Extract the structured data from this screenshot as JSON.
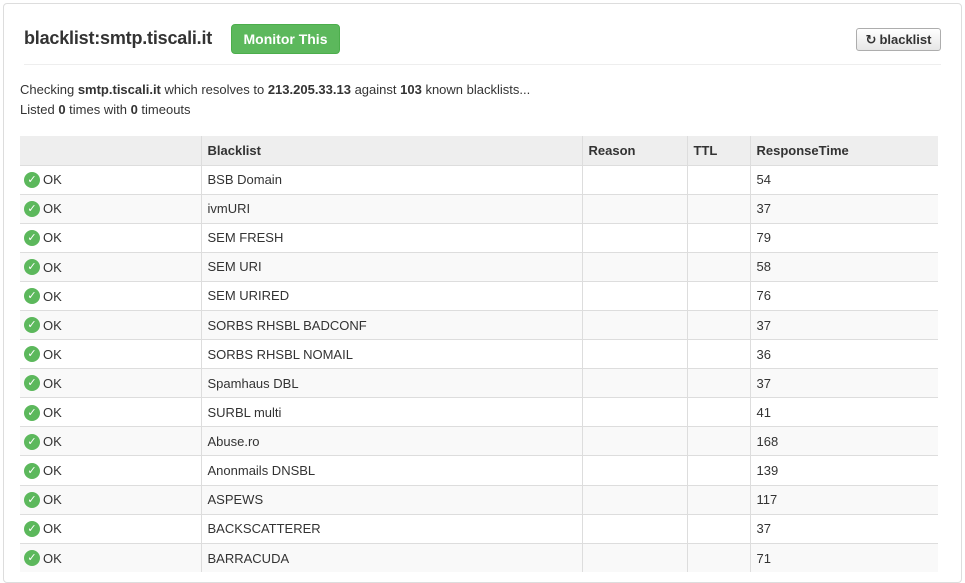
{
  "header": {
    "title": "blacklist:smtp.tiscali.it",
    "monitor_label": "Monitor This",
    "refresh_label": "blacklist",
    "refresh_icon": "refresh-icon"
  },
  "info": {
    "checking_prefix": "Checking ",
    "host": "smtp.tiscali.it",
    "resolves_text": " which resolves to ",
    "ip": "213.205.33.13",
    "against_text": " against ",
    "count": "103",
    "known_text": " known blacklists...",
    "listed_prefix": "Listed ",
    "listed_count": "0",
    "times_with": " times with ",
    "timeout_count": "0",
    "timeouts_text": " timeouts"
  },
  "table": {
    "columns": [
      "",
      "Blacklist",
      "Reason",
      "TTL",
      "ResponseTime"
    ],
    "rows": [
      {
        "status": "OK",
        "blacklist": "BSB Domain",
        "reason": "",
        "ttl": "",
        "response": "54"
      },
      {
        "status": "OK",
        "blacklist": "ivmURI",
        "reason": "",
        "ttl": "",
        "response": "37"
      },
      {
        "status": "OK",
        "blacklist": "SEM FRESH",
        "reason": "",
        "ttl": "",
        "response": "79"
      },
      {
        "status": "OK",
        "blacklist": "SEM URI",
        "reason": "",
        "ttl": "",
        "response": "58"
      },
      {
        "status": "OK",
        "blacklist": "SEM URIRED",
        "reason": "",
        "ttl": "",
        "response": "76"
      },
      {
        "status": "OK",
        "blacklist": "SORBS RHSBL BADCONF",
        "reason": "",
        "ttl": "",
        "response": "37"
      },
      {
        "status": "OK",
        "blacklist": "SORBS RHSBL NOMAIL",
        "reason": "",
        "ttl": "",
        "response": "36"
      },
      {
        "status": "OK",
        "blacklist": "Spamhaus DBL",
        "reason": "",
        "ttl": "",
        "response": "37"
      },
      {
        "status": "OK",
        "blacklist": "SURBL multi",
        "reason": "",
        "ttl": "",
        "response": "41"
      },
      {
        "status": "OK",
        "blacklist": "Abuse.ro",
        "reason": "",
        "ttl": "",
        "response": "168"
      },
      {
        "status": "OK",
        "blacklist": "Anonmails DNSBL",
        "reason": "",
        "ttl": "",
        "response": "139"
      },
      {
        "status": "OK",
        "blacklist": "ASPEWS",
        "reason": "",
        "ttl": "",
        "response": "117"
      },
      {
        "status": "OK",
        "blacklist": "BACKSCATTERER",
        "reason": "",
        "ttl": "",
        "response": "37"
      },
      {
        "status": "OK",
        "blacklist": "BARRACUDA",
        "reason": "",
        "ttl": "",
        "response": "71"
      }
    ]
  },
  "colors": {
    "ok_green": "#5cb85c",
    "header_bg": "#eeeeee"
  }
}
